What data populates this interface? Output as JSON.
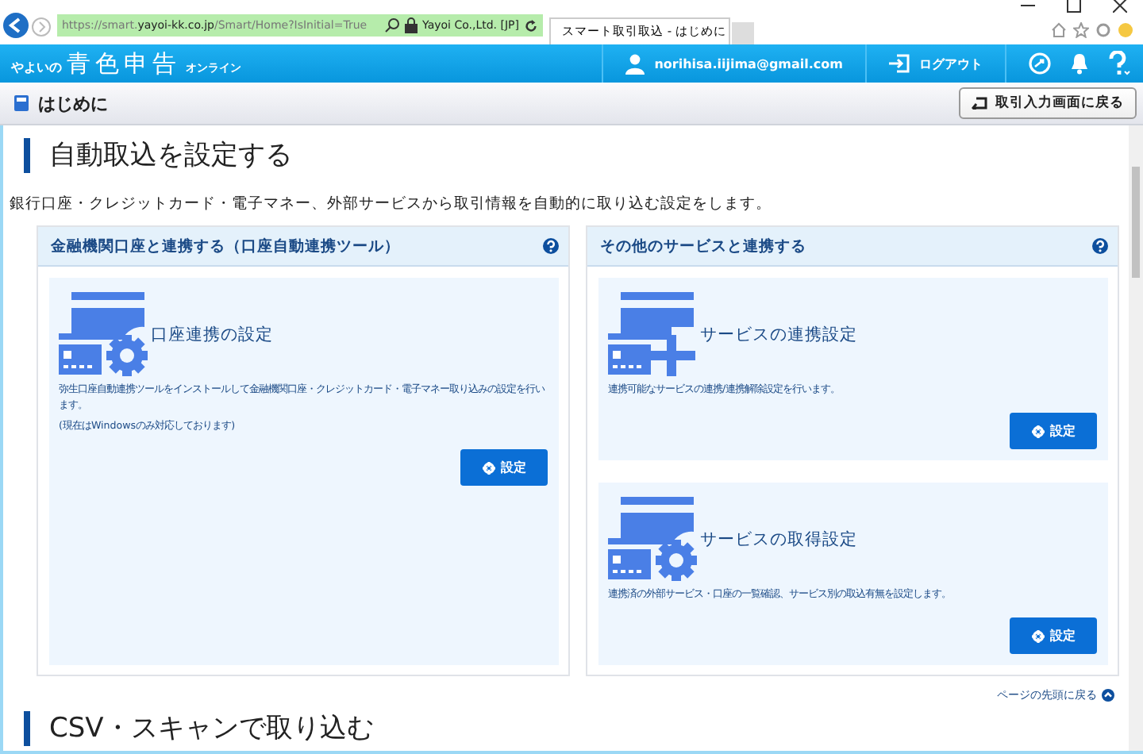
{
  "browser": {
    "url_prefix": "https://smart.",
    "url_domain": "yayoi-kk.co.jp",
    "url_path": "/Smart/Home?IsInitial=True",
    "certificate": "Yayoi Co.,Ltd. [JP]",
    "tab": "スマート取引取込 - はじめに"
  },
  "header": {
    "logo_small": "やよいの",
    "logo_main": "青色申告",
    "logo_suffix": "オンライン",
    "user": "norihisa.iijima@gmail.com",
    "logout": "ログアウト"
  },
  "subheader": {
    "title": "はじめに",
    "back_button": "取引入力画面に戻る"
  },
  "section": {
    "title": "自動取込を設定する",
    "intro": "銀行口座・クレジットカード・電子マネー、外部サービスから取引情報を自動的に取り込む設定をします。"
  },
  "panels": [
    {
      "title": "金融機関口座と連携する（口座自動連携ツール）",
      "cards": [
        {
          "kind": "gear",
          "title": "口座連携の設定",
          "description": [
            "弥生口座自動連携ツールをインストールして金融機関口座・クレジットカード・電子マネー取り込みの設定を行います。",
            "(現在はWindowsのみ対応しております)"
          ],
          "button": "設定"
        }
      ]
    },
    {
      "title": "その他のサービスと連携する",
      "cards": [
        {
          "kind": "plus",
          "title": "サービスの連携設定",
          "description": [
            "連携可能なサービスの連携/連携解除設定を行います。"
          ],
          "button": "設定"
        },
        {
          "kind": "gear",
          "title": "サービスの取得設定",
          "description": [
            "連携済の外部サービス・口座の一覧確認、サービス別の取込有無を設定します。"
          ],
          "button": "設定"
        }
      ]
    }
  ],
  "back_to_top": "ページの先頭に戻る",
  "next_section": {
    "title": "CSV・スキャンで取り込む"
  }
}
